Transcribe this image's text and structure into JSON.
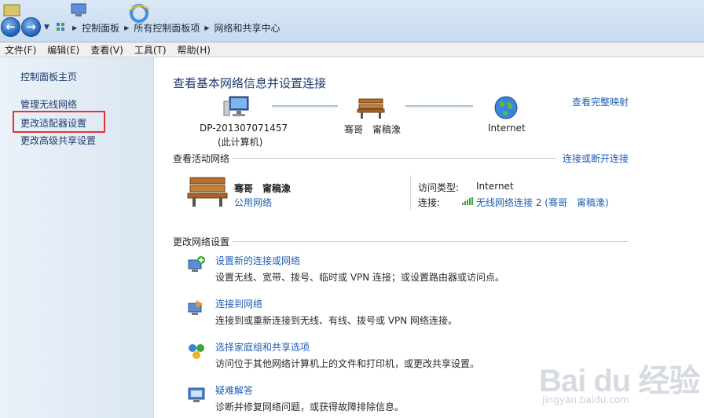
{
  "address_bar": {
    "breadcrumbs": [
      "控制面板",
      "所有控制面板项",
      "网络和共享中心"
    ]
  },
  "menu": [
    "文件(F)",
    "编辑(E)",
    "查看(V)",
    "工具(T)",
    "帮助(H)"
  ],
  "left_pane": {
    "items": [
      "控制面板主页",
      "管理无线网络",
      "更改适配器设置",
      "更改高级共享设置"
    ]
  },
  "main": {
    "title": "查看基本网络信息并设置连接",
    "full_map_link": "查看完整映射",
    "nodes": {
      "computer_name": "DP-201307071457",
      "computer_sub": "(此计算机)",
      "network_name": "骞哥　甯稿潒",
      "internet": "Internet"
    },
    "active_section": {
      "title": "查看活动网络",
      "action_link": "连接或断开连接",
      "network_name": "骞哥　甯稿潒",
      "network_type": "公用网络",
      "access_label": "访问类型:",
      "access_value": "Internet",
      "connection_label": "连接:",
      "connection_value": "无线网络连接 2 (骞哥　甯稿潒)"
    },
    "change_section": {
      "title": "更改网络设置",
      "tasks": [
        {
          "title": "设置新的连接或网络",
          "desc": "设置无线、宽带、拨号、临时或 VPN 连接；或设置路由器或访问点。",
          "icon": "new-connection-icon"
        },
        {
          "title": "连接到网络",
          "desc": "连接到或重新连接到无线、有线、拨号或 VPN 网络连接。",
          "icon": "connect-network-icon"
        },
        {
          "title": "选择家庭组和共享选项",
          "desc": "访问位于其他网络计算机上的文件和打印机，或更改共享设置。",
          "icon": "homegroup-icon"
        },
        {
          "title": "疑难解答",
          "desc": "诊断并修复网络问题，或获得故障排除信息。",
          "icon": "troubleshoot-icon"
        }
      ]
    }
  },
  "watermark": {
    "logo": "Bai du 经验",
    "url": "jingyan.baidu.com"
  }
}
